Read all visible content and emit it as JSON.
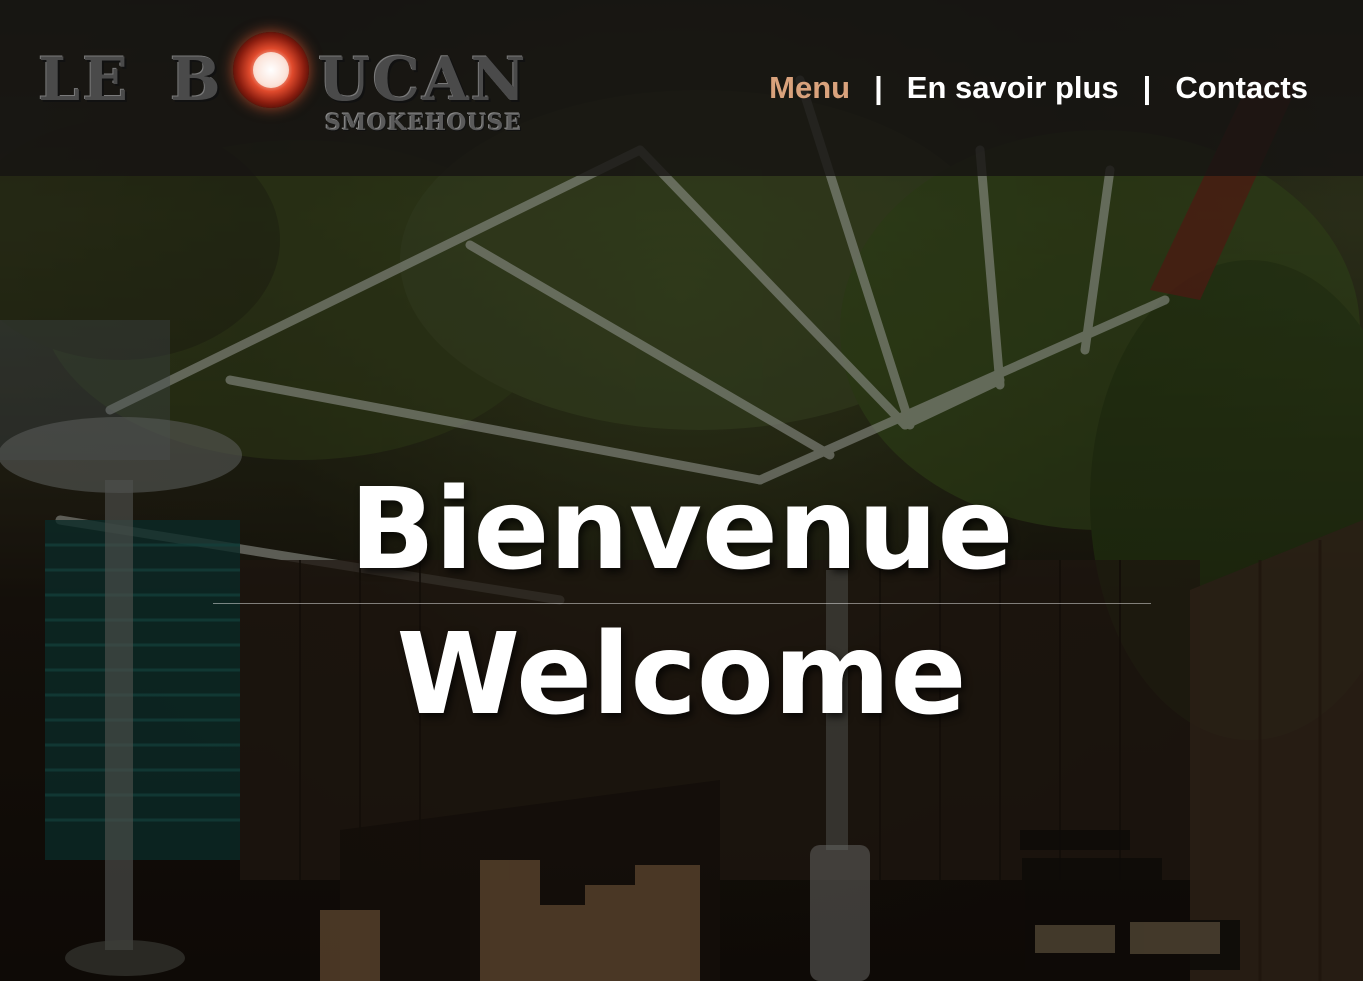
{
  "logo": {
    "word_le": "LE",
    "word_b": "B",
    "word_ucan": "UCAN",
    "subtitle": "SMOKEHOUSE"
  },
  "nav": {
    "items": [
      {
        "label": "Menu",
        "active": true
      },
      {
        "label": "En savoir plus",
        "active": false
      },
      {
        "label": "Contacts",
        "active": false
      }
    ],
    "separator": "|"
  },
  "hero": {
    "line1": "Bienvenue",
    "line2": "Welcome"
  },
  "colors": {
    "nav_active": "#d9a27c",
    "nav_text": "#ffffff",
    "header_bg": "#161412"
  }
}
